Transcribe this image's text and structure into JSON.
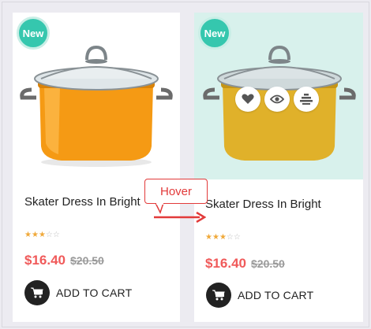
{
  "products": [
    {
      "badge": "New",
      "title": "Skater Dress In Bright",
      "rating": 3,
      "rating_max": 5,
      "price": "$16.40",
      "old_price": "$20.50",
      "cart_label": "ADD TO CART"
    },
    {
      "badge": "New",
      "title": "Skater Dress In Bright",
      "rating": 3,
      "rating_max": 5,
      "price": "$16.40",
      "old_price": "$20.50",
      "cart_label": "ADD TO CART",
      "hover_actions": [
        "heart-icon",
        "eye-icon",
        "compare-icon"
      ]
    }
  ],
  "annotation": {
    "label": "Hover",
    "color": "#e23a3a"
  },
  "colors": {
    "badge": "#35c7ae",
    "price": "#f05a5a",
    "hover_background": "#d8f1ec",
    "star": "#f0a93a"
  }
}
